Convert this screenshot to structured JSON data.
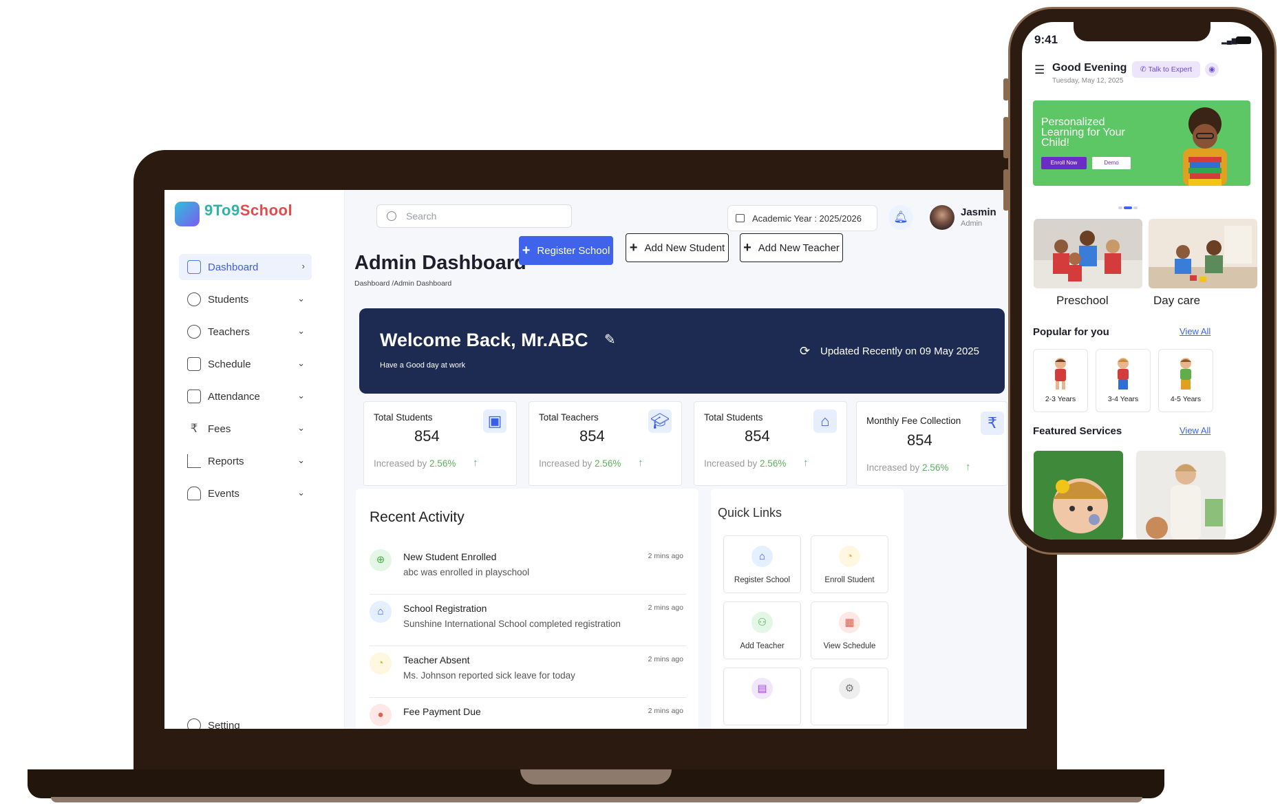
{
  "brand": {
    "name_part1": "9To9",
    "name_part2": "School"
  },
  "sidebar": {
    "items": [
      {
        "label": "Dashboard"
      },
      {
        "label": "Students"
      },
      {
        "label": "Teachers"
      },
      {
        "label": "Schedule"
      },
      {
        "label": "Attendance"
      },
      {
        "label": "Fees"
      },
      {
        "label": "Reports"
      },
      {
        "label": "Events"
      }
    ],
    "setting": "Setting"
  },
  "header": {
    "search_placeholder": "Search",
    "academic_year": "Academic Year : 2025/2026",
    "user_name": "Jasmin",
    "user_role": "Admin"
  },
  "page": {
    "title": "Admin Dashboard",
    "breadcrumb": "Dashboard /Admin Dashboard",
    "actions": {
      "register": "Register School",
      "add_student": "Add New Student",
      "add_teacher": "Add New Teacher"
    }
  },
  "banner": {
    "welcome": "Welcome Back, Mr.ABC",
    "subtitle": "Have a Good day at work",
    "updated": "Updated Recently on 09 May 2025"
  },
  "stats": [
    {
      "label": "Total Students",
      "value": "854",
      "prefix": "Increased by ",
      "pct": "2.56%",
      "arrow": "↑"
    },
    {
      "label": "Total Teachers",
      "value": "854",
      "prefix": "Increased by ",
      "pct": "2.56%",
      "arrow": "↑"
    },
    {
      "label": "Total Students",
      "value": "854",
      "prefix": "Increased by ",
      "pct": "2.56%",
      "arrow": "↑"
    },
    {
      "label": "Monthly Fee Collection",
      "value": "854",
      "prefix": "Increased by ",
      "pct": "2.56%",
      "arrow": "↑",
      "currency": "₹"
    }
  ],
  "recent": {
    "title": "Recent Activity",
    "items": [
      {
        "title": "New Student Enrolled",
        "desc": "abc was enrolled in playschool",
        "time": "2 mins ago"
      },
      {
        "title": "School Registration",
        "desc": "Sunshine International School completed registration",
        "time": "2 mins ago"
      },
      {
        "title": "Teacher Absent",
        "desc": "Ms. Johnson reported sick leave for today",
        "time": "2 mins ago"
      },
      {
        "title": "Fee Payment Due",
        "desc": "",
        "time": "2 mins ago"
      }
    ]
  },
  "quick": {
    "title": "Quick Links",
    "items": [
      {
        "label": "Register School"
      },
      {
        "label": "Enroll Student"
      },
      {
        "label": "Add Teacher"
      },
      {
        "label": "View Schedule"
      }
    ]
  },
  "phone": {
    "time": "9:41",
    "greeting": "Good Evening",
    "date": "Tuesday, May 12, 2025",
    "expert": "✆ Talk to Expert",
    "hero_title": "Personalized Learning for Your Child!",
    "enroll": "Enroll Now",
    "demo": "Demo",
    "categories": [
      {
        "label": "Preschool"
      },
      {
        "label": "Day care"
      }
    ],
    "popular_title": "Popular for you",
    "view_all": "View All",
    "ages": [
      {
        "label": "2-3 Years"
      },
      {
        "label": "3-4 Years"
      },
      {
        "label": "4-5 Years"
      }
    ],
    "featured_title": "Featured Services"
  },
  "colors": {
    "accent": "#3f63ea",
    "banner": "#1d2a52",
    "positive": "#58b05d",
    "laptop": "#2a1a10",
    "hero": "#5dc766"
  }
}
